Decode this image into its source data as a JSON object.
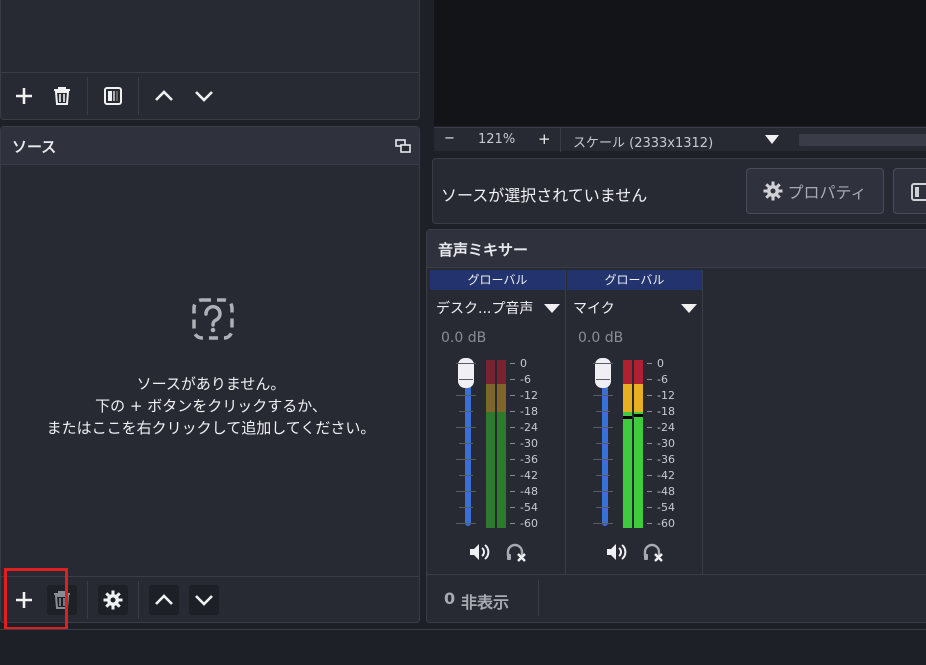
{
  "scenes_panel": {
    "toolbar": {
      "add_icon": "plus-icon",
      "remove_icon": "trash-icon",
      "filter_icon": "filter-icon",
      "up_icon": "chevron-up-icon",
      "down_icon": "chevron-down-icon"
    }
  },
  "sources_panel": {
    "title": "ソース",
    "empty_icon": "question-icon",
    "empty_line1": "ソースがありません。",
    "empty_line2": "下の + ボタンをクリックするか、",
    "empty_line3": "またはここを右クリックして追加してください。",
    "toolbar": {
      "add_icon": "plus-icon",
      "remove_icon": "trash-icon",
      "settings_icon": "gear-icon",
      "up_icon": "chevron-up-icon",
      "down_icon": "chevron-down-icon"
    }
  },
  "preview": {
    "zoom_minus": "−",
    "zoom_value": "121%",
    "zoom_plus": "+",
    "scale_label": "スケール (2333x1312)"
  },
  "properties_bar": {
    "no_source_text": "ソースが選択されていません",
    "properties_button": "プロパティ"
  },
  "audio_mixer": {
    "title": "音声ミキサー",
    "channels": [
      {
        "tag": "グローバル",
        "name": "デスク...プ音声",
        "db": "0.0 dB",
        "volume_level": 1.0
      },
      {
        "tag": "グローバル",
        "name": "マイク",
        "db": "0.0 dB",
        "volume_level": 1.0
      }
    ],
    "scale_labels": [
      "0",
      "-6",
      "-12",
      "-18",
      "-24",
      "-30",
      "-36",
      "-42",
      "-48",
      "-54",
      "-60"
    ],
    "hidden_count": "0",
    "hidden_label": "非表示"
  },
  "colors": {
    "accent": "#3a6fd8",
    "meter_green_dark": "#2d7a2d",
    "meter_green_bright": "#3ecc3e",
    "meter_yellow": "#e8b020",
    "meter_red": "#b02030",
    "highlight": "#e02020",
    "global_tag_bg": "#22336e"
  }
}
